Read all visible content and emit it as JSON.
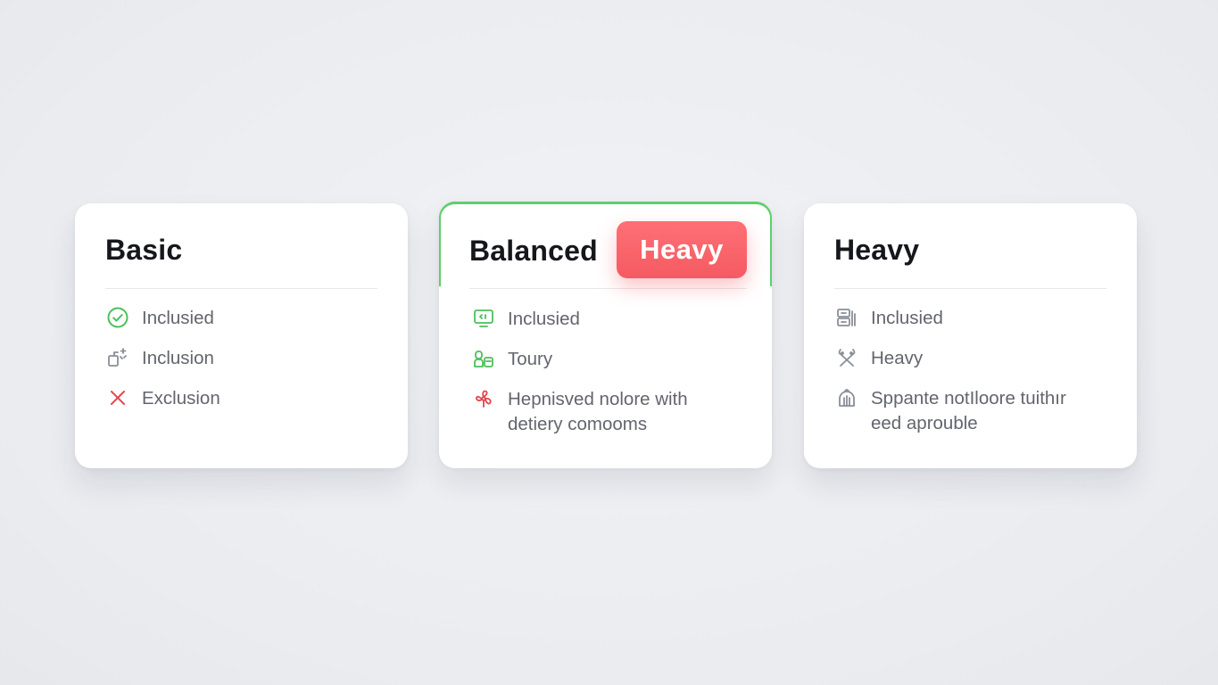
{
  "plans": {
    "basic": {
      "title": "Basic",
      "items": [
        {
          "icon": "check-circle-icon",
          "label": "Inclusied"
        },
        {
          "icon": "square-sparkle-icon",
          "label": "Inclusion"
        },
        {
          "icon": "x-mark-icon",
          "label": "Exclusion"
        }
      ]
    },
    "balanced": {
      "title": "Balanced",
      "badge": "Heavy",
      "items": [
        {
          "icon": "monitor-icon",
          "label": "Inclusied"
        },
        {
          "icon": "group-icon",
          "label": "Toury"
        },
        {
          "icon": "fan-icon",
          "label": "Hepnisved nolore with detiery comooms"
        }
      ]
    },
    "heavy": {
      "title": "Heavy",
      "items": [
        {
          "icon": "layout-icon",
          "label": "Inclusied"
        },
        {
          "icon": "cross-tools-icon",
          "label": "Heavy"
        },
        {
          "icon": "hand-icon",
          "label": "Sppante notIloore tuithır eed aproublе"
        }
      ]
    }
  },
  "colors": {
    "accent_green": "#5fcf6b",
    "badge_red": "#f55a62",
    "exclusion_red": "#e2464b",
    "icon_gray": "#8a8e96"
  }
}
